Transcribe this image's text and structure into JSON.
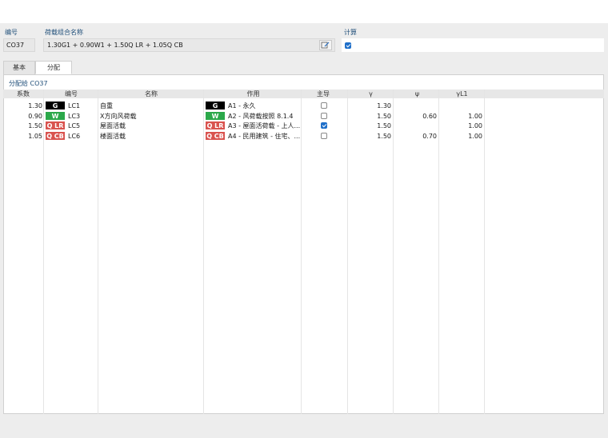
{
  "header": {
    "id_label": "编号",
    "id_value": "CO37",
    "name_label": "荷载组合名称",
    "name_value": "1.30G1 + 0.90W1 + 1.50Q LR + 1.05Q CB",
    "calc_label": "计算",
    "calc_checked": true
  },
  "tabs": [
    {
      "label": "基本",
      "active": false
    },
    {
      "label": "分配",
      "active": true
    }
  ],
  "section_title": "分配给 CO37",
  "table": {
    "headers": {
      "factor": "系数",
      "id": "编号",
      "name": "名称",
      "action": "作用",
      "leading": "主导",
      "gamma": "γ",
      "psi": "ψ",
      "gamma_l1": "γL1"
    },
    "rows": [
      {
        "factor": "1.30",
        "badge": "G",
        "badge_color": "#000000",
        "lc": "LC1",
        "name": "自重",
        "action_badge": "G",
        "action_badge_color": "#000000",
        "action": "A1 - 永久",
        "leading": false,
        "gamma": "1.30",
        "psi": "",
        "gamma_l1": ""
      },
      {
        "factor": "0.90",
        "badge": "W",
        "badge_color": "#2ba84a",
        "lc": "LC3",
        "name": "X方向风荷载",
        "action_badge": "W",
        "action_badge_color": "#2ba84a",
        "action": "A2 - 风荷载按照 8.1.4",
        "leading": false,
        "gamma": "1.50",
        "psi": "0.60",
        "gamma_l1": "1.00"
      },
      {
        "factor": "1.50",
        "badge": "Q LR",
        "badge_color": "#d9534f",
        "lc": "LC5",
        "name": "屋面活载",
        "action_badge": "Q LR",
        "action_badge_color": "#d9534f",
        "action": "A3 - 屋面活荷载 - 上人...",
        "leading": true,
        "gamma": "1.50",
        "psi": "",
        "gamma_l1": "1.00"
      },
      {
        "factor": "1.05",
        "badge": "Q CB",
        "badge_color": "#d9534f",
        "lc": "LC6",
        "name": "楼面活载",
        "action_badge": "Q CB",
        "action_badge_color": "#d9534f",
        "action": "A4 - 民用建筑 - 住宅、...",
        "leading": false,
        "gamma": "1.50",
        "psi": "0.70",
        "gamma_l1": "1.00"
      }
    ]
  }
}
